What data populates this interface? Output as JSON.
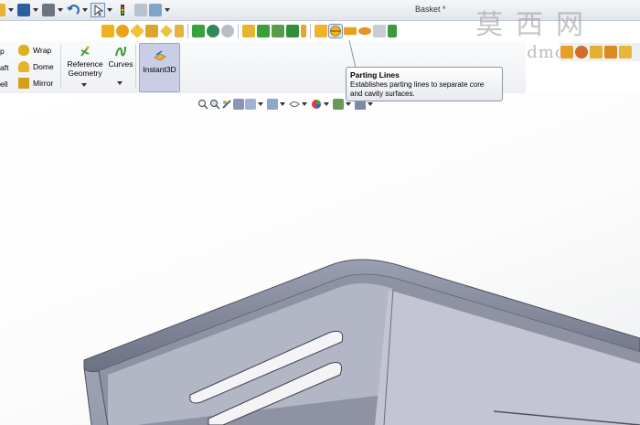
{
  "window": {
    "document_title": "Basket *"
  },
  "watermark": {
    "text": "莫西网",
    "url": "www.3dmoxi.com"
  },
  "quick_access": {
    "icons": [
      "new-icon",
      "save-icon",
      "print-icon",
      "undo-icon",
      "select-icon",
      "rebuild-icon",
      "file-properties-icon",
      "options-icon"
    ]
  },
  "mold_toolbar": {
    "icons": [
      "draft-analysis-icon",
      "undercut-analysis-icon",
      "parting-line-analysis-icon",
      "scale-icon",
      "interlock-surface-icon",
      "shut-off-surfaces-icon",
      "parting-surfaces-icon",
      "ruled-surface-icon",
      "core-icon",
      "tooling-split-icon",
      "offset-surface-icon",
      "knit-surface-icon",
      "delete-face-icon",
      "radiate-surface-icon",
      "parting-lines-icon",
      "shut-off-icon",
      "split-line-icon",
      "move-face-icon",
      "insert-mold-folders-icon"
    ],
    "active": "parting-lines-icon"
  },
  "ribbon": {
    "left_partial": [
      "p",
      "aft",
      "ell"
    ],
    "group1": [
      {
        "icon": "wrap-icon",
        "label": "Wrap"
      },
      {
        "icon": "dome-icon",
        "label": "Dome"
      },
      {
        "icon": "mirror-icon",
        "label": "Mirror"
      }
    ],
    "reference_geometry": {
      "line1": "Reference",
      "line2": "Geometry"
    },
    "curves": "Curves",
    "instant3d": "Instant3D"
  },
  "tooltip": {
    "title": "Parting Lines",
    "description_line1": "Establishes parting lines to separate core",
    "description_line2": "and cavity surfaces."
  },
  "view_toolbar": {
    "icons": [
      "zoom-to-fit-icon",
      "zoom-to-area-icon",
      "previous-view-icon",
      "section-view-icon",
      "view-orientation-icon",
      "display-style-icon",
      "hide-show-items-icon",
      "edit-appearance-icon",
      "apply-scene-icon",
      "view-settings-icon"
    ]
  },
  "colors": {
    "accent": "#6e8fbf",
    "model": "#7b7f8f",
    "instant3d_bg": "#c9cde6",
    "tooltip_border": "#8c96a3"
  }
}
